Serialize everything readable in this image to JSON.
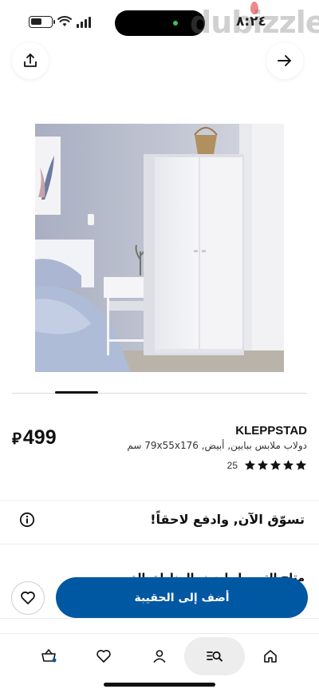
{
  "status_bar": {
    "time": "٨:٢٤",
    "battery_level": 0.55,
    "watermark": "dubizzle"
  },
  "top_actions": {
    "share_icon": "share-icon",
    "next_icon": "arrow-right-icon"
  },
  "carousel": {
    "active_index": 1,
    "total": 7
  },
  "product": {
    "brand": "KLEPPSTAD",
    "description": "دولاب ملابس ببابين, أبيض, 79x55x176 سم",
    "rating": 5,
    "rating_count": "25",
    "price": "499",
    "currency": "⃁"
  },
  "bnpl": {
    "text": "تسوّق الآن, وادفع لاحقاً!",
    "icon": "info-icon"
  },
  "hidden_row": {
    "text": "متاح التوصيل لبعض المناطق الق"
  },
  "actions": {
    "add_to_bag": "أضف إلى الحقيبة",
    "wishlist_icon": "heart-icon"
  },
  "bottom_nav": [
    {
      "name": "cart",
      "icon": "basket-icon"
    },
    {
      "name": "favourites",
      "icon": "heart-icon"
    },
    {
      "name": "profile",
      "icon": "person-icon"
    },
    {
      "name": "search",
      "icon": "search-list-icon",
      "active": true
    },
    {
      "name": "home",
      "icon": "home-icon"
    }
  ],
  "colors": {
    "primary_button": "#0058a3",
    "active_nav_bg": "#ededed",
    "text": "#111111"
  }
}
